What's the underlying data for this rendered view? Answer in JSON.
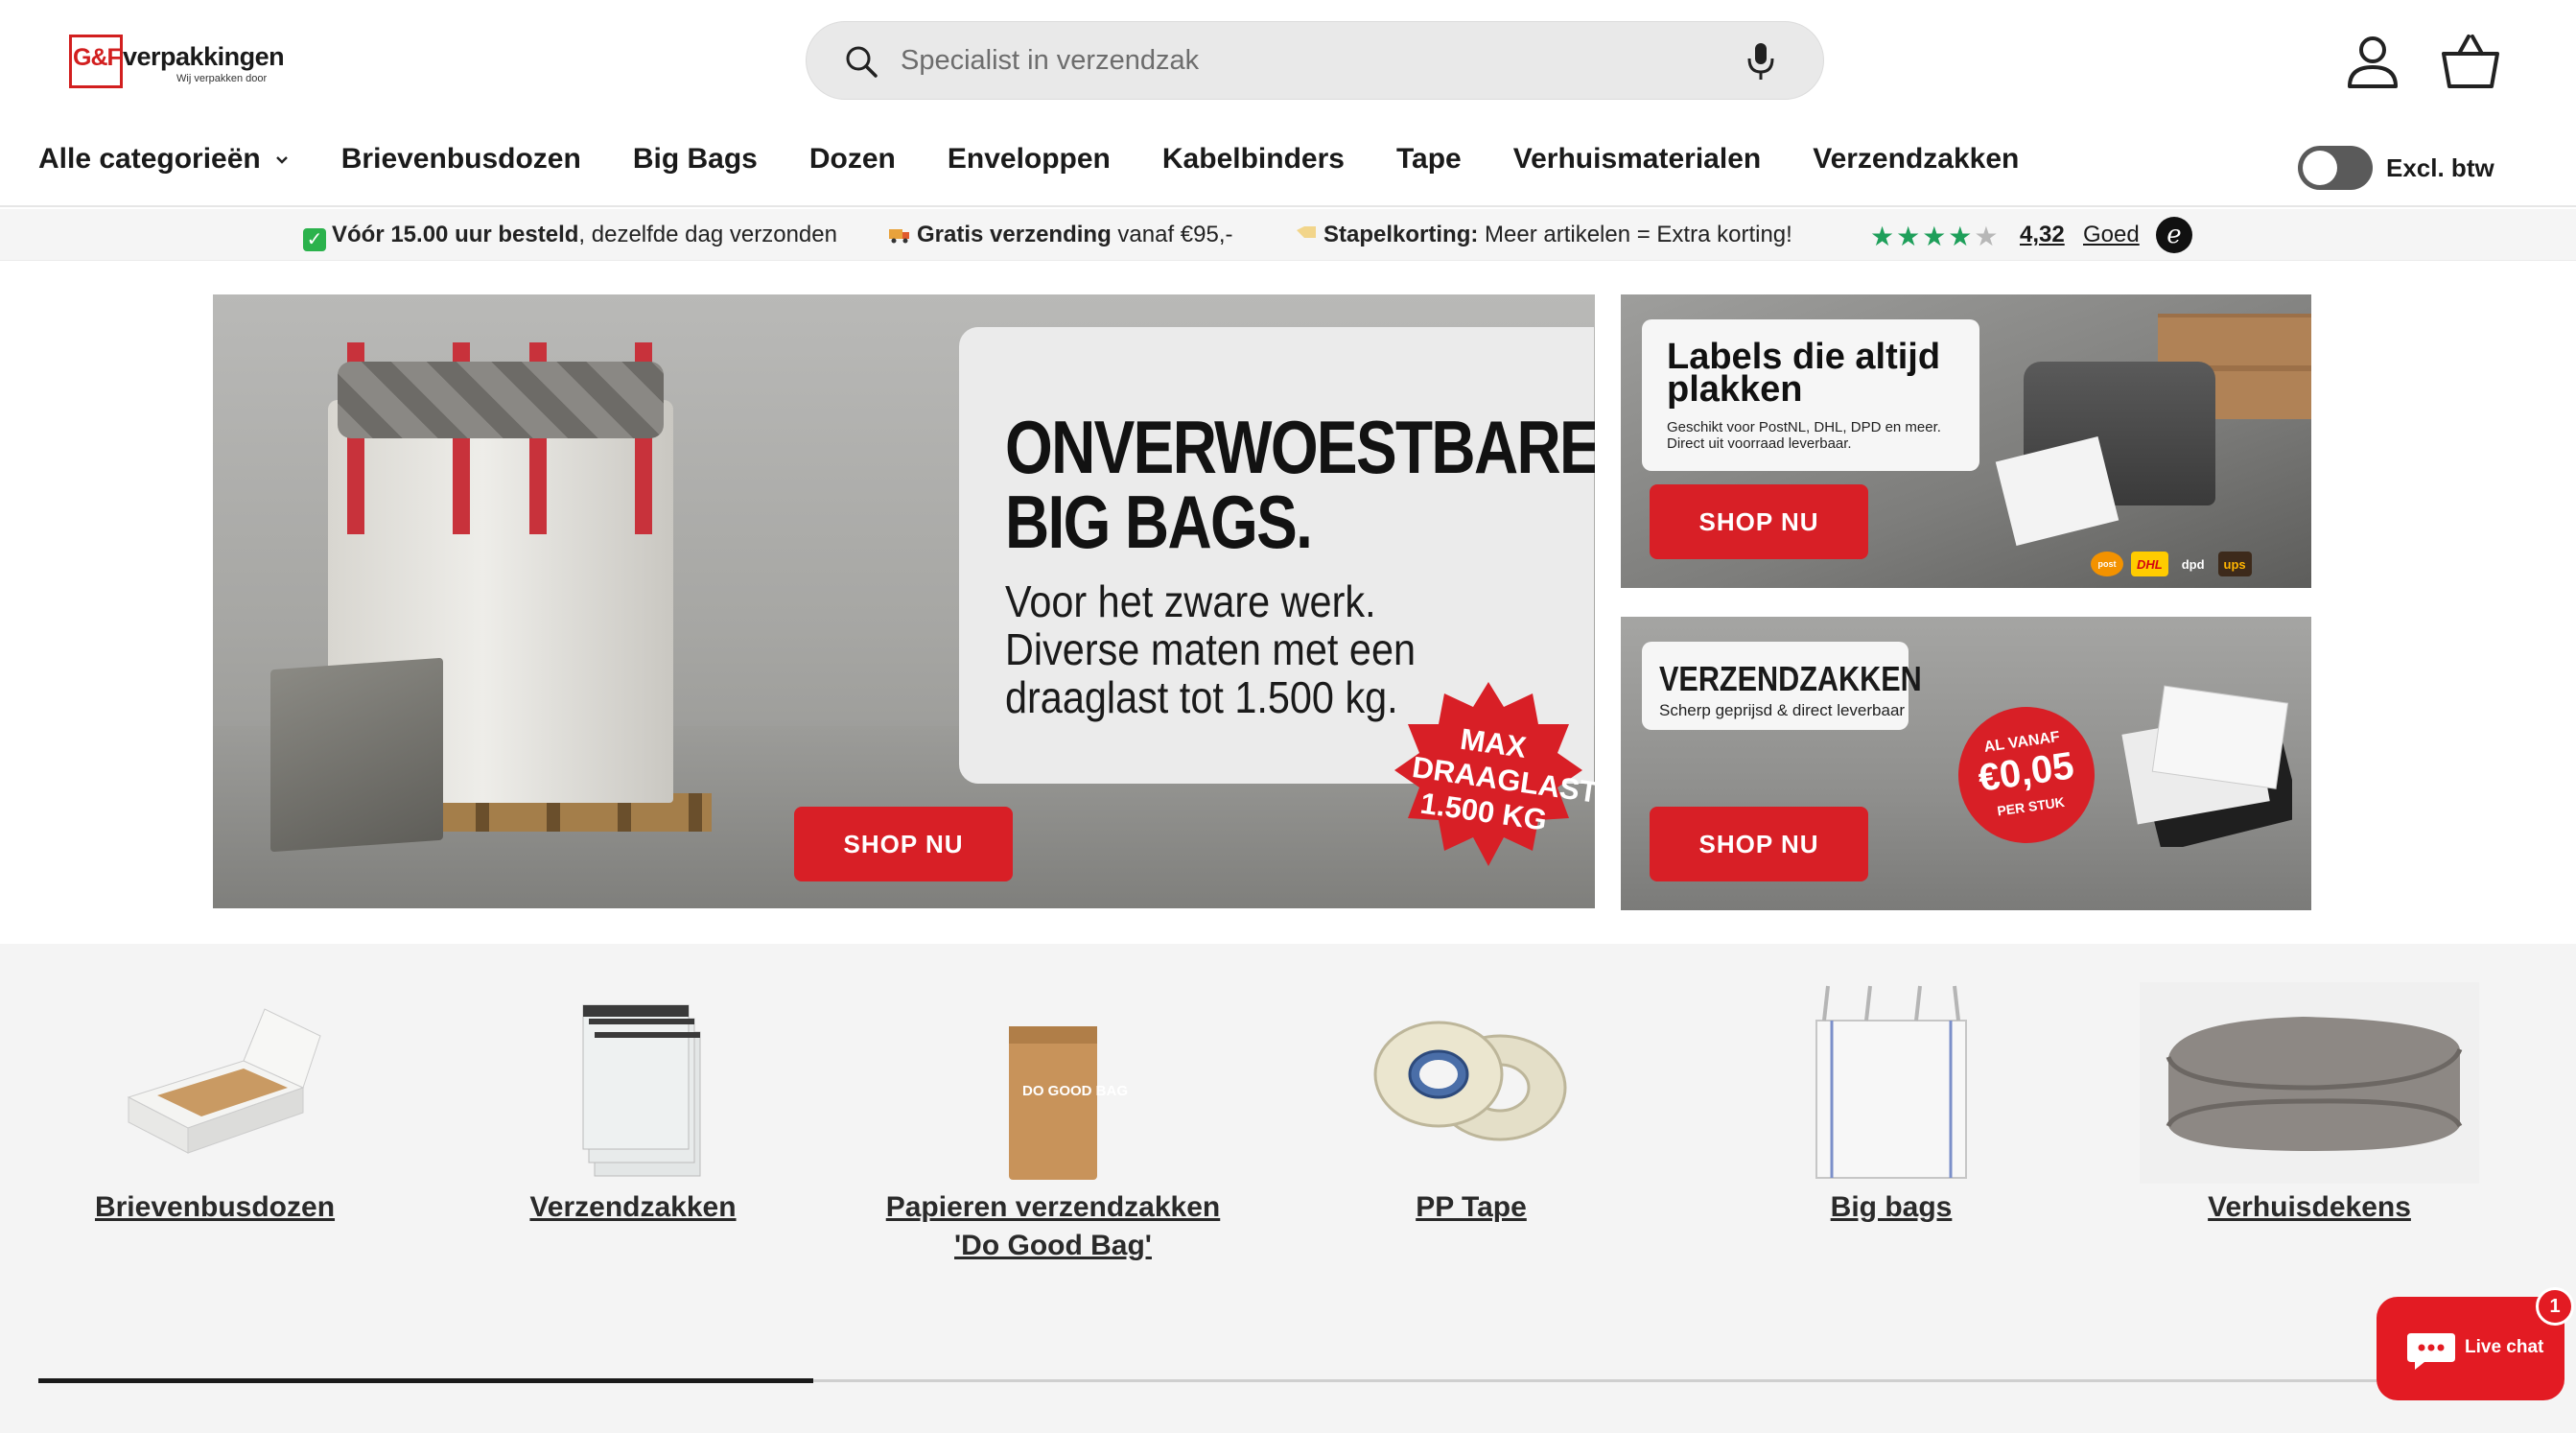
{
  "brand": {
    "logo_mark": "G&F",
    "logo_name": "verpakkingen",
    "tagline": "Wij verpakken door"
  },
  "search": {
    "placeholder": "Specialist in verzendzak"
  },
  "nav": {
    "items": [
      {
        "label": "Alle categorieën",
        "has_dropdown": true
      },
      {
        "label": "Brievenbusdozen"
      },
      {
        "label": "Big Bags"
      },
      {
        "label": "Dozen"
      },
      {
        "label": "Enveloppen"
      },
      {
        "label": "Kabelbinders"
      },
      {
        "label": "Tape"
      },
      {
        "label": "Verhuismaterialen"
      },
      {
        "label": "Verzendzakken"
      }
    ]
  },
  "vat_toggle": {
    "label": "Excl. btw",
    "on": false
  },
  "usp": [
    {
      "icon": "check-icon",
      "bold": "Vóór 15.00 uur besteld",
      "text": ", dezelfde dag verzonden"
    },
    {
      "icon": "truck-icon",
      "bold": "Gratis verzending",
      "text": " vanaf €95,-"
    },
    {
      "icon": "tag-icon",
      "bold": "Stapelkorting:",
      "text": " Meer artikelen = Extra korting!"
    }
  ],
  "rating": {
    "stars": "★★★★",
    "half_star": "★",
    "score": "4,32",
    "word": "Goed",
    "provider_mark": "e"
  },
  "hero": {
    "title_line1": "ONVERWOESTBARE",
    "title_line2": "BIG BAGS.",
    "sub_line1": "Voor het zware werk.",
    "sub_line2": "Diverse maten met een",
    "sub_line3": "draaglast tot 1.500 kg.",
    "badge_line1": "MAX",
    "badge_line2": "DRAAGLAST",
    "badge_line3": "1.500 KG",
    "button": "SHOP NU"
  },
  "side_banner_1": {
    "title_line1": "Labels die altijd",
    "title_line2": "plakken",
    "sub_line1": "Geschikt voor PostNL, DHL, DPD en meer.",
    "sub_line2": "Direct uit voorraad leverbaar.",
    "button": "SHOP NU",
    "carriers": [
      "post",
      "DHL",
      "dpd",
      "ups"
    ]
  },
  "side_banner_2": {
    "title": "VERZENDZAKKEN",
    "sub": "Scherp geprijsd & direct leverbaar",
    "price_pre": "AL VANAF",
    "price": "€0,05",
    "price_post": "PER STUK",
    "button": "SHOP NU"
  },
  "categories": [
    {
      "label": "Brievenbusdozen",
      "icon": "mailbox-box-icon"
    },
    {
      "label": "Verzendzakken",
      "icon": "mailer-bag-icon"
    },
    {
      "label": "Papieren verzendzakken 'Do Good Bag'",
      "icon": "paper-bag-icon",
      "bag_text": "DO GOOD BAG"
    },
    {
      "label": "PP Tape",
      "icon": "tape-roll-icon"
    },
    {
      "label": "Big bags",
      "icon": "big-bag-icon"
    },
    {
      "label": "Verhuisdekens",
      "icon": "moving-blanket-icon"
    }
  ],
  "carousel": {
    "progress": 0.31
  },
  "chat": {
    "label": "Live chat",
    "badge": "1"
  },
  "colors": {
    "accent": "#d81f26",
    "usp_bg": "#f5f5f5",
    "section_bg": "#f4f4f4",
    "rating_green": "#1e9f5a"
  }
}
